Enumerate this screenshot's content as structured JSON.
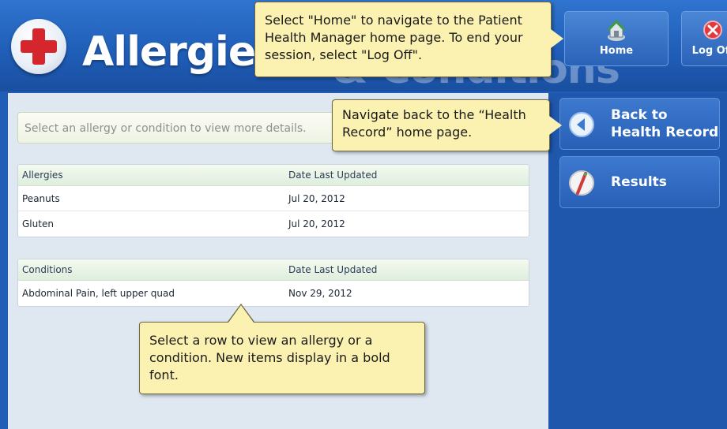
{
  "header": {
    "title": "Allergies",
    "title_ghost": "& Conditions",
    "home_label": "Home",
    "logoff_label": "Log Off"
  },
  "search": {
    "placeholder": "Select an allergy or condition to view more details."
  },
  "allergies_table": {
    "col1": "Allergies",
    "col2": "Date Last Updated",
    "rows": [
      {
        "name": "Peanuts",
        "date": "Jul 20, 2012"
      },
      {
        "name": "Gluten",
        "date": "Jul 20, 2012"
      }
    ]
  },
  "conditions_table": {
    "col1": "Conditions",
    "col2": "Date Last Updated",
    "rows": [
      {
        "name": "Abdominal Pain, left upper quad",
        "date": "Nov 29, 2012"
      }
    ]
  },
  "sidebar": {
    "back_label": "Back to\nHealth Record",
    "results_label": "Results"
  },
  "callouts": {
    "home": "Select \"Home\" to navigate to the Patient Health Manager home page. To end your session, select \"Log Off\".",
    "back": "Navigate back to the “Health Record” home page.",
    "row": "Select a row to view an allergy or a condition. New items display in a bold font."
  },
  "colors": {
    "header_blue": "#1f5db6",
    "content_bg": "#dfe8f1",
    "callout_bg": "#fbf1b0",
    "logo_red": "#d4262c"
  },
  "icons": [
    "red-cross-logo-icon",
    "home-icon",
    "close-icon",
    "back-arrow-icon",
    "results-icon"
  ]
}
